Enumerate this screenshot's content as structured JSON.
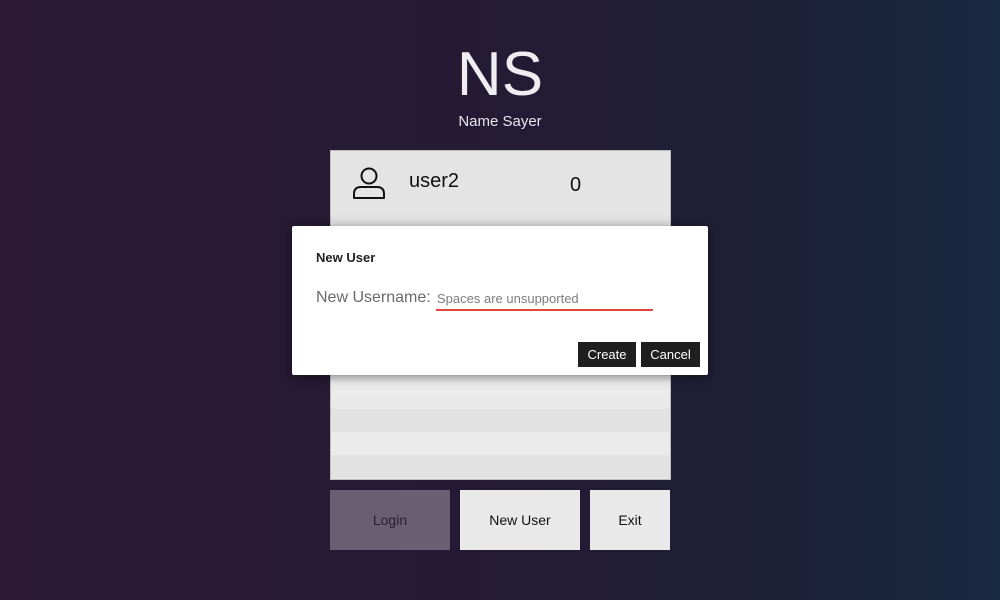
{
  "header": {
    "title": "NS",
    "subtitle": "Name Sayer"
  },
  "user_list": {
    "users": [
      {
        "name": "user2",
        "score": "0",
        "icon": "user-icon"
      }
    ]
  },
  "buttons": {
    "login": "Login",
    "new_user": "New User",
    "exit": "Exit"
  },
  "dialog": {
    "title": "New User",
    "field_label": "New Username:",
    "input_value": "",
    "input_placeholder": "Spaces are unsupported",
    "create_label": "Create",
    "cancel_label": "Cancel"
  },
  "colors": {
    "input_underline": "#e0473a",
    "login_button_bg": "#6a5f72",
    "dialog_button_bg": "#1f1f1f"
  }
}
